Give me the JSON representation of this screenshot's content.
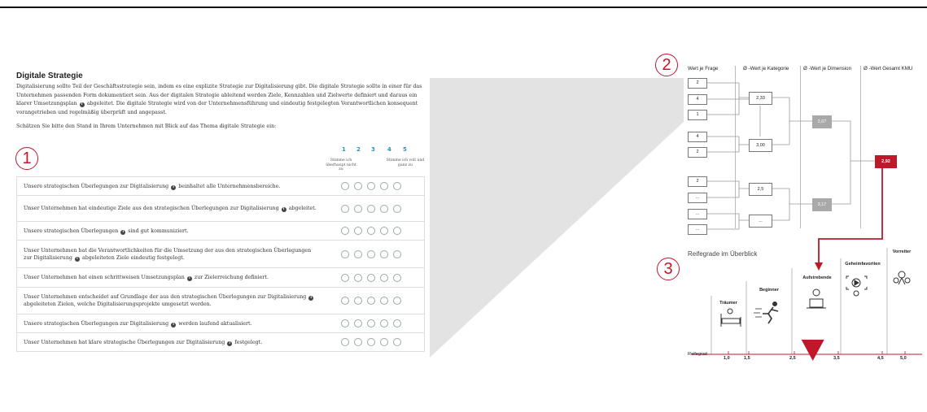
{
  "survey": {
    "title": "Digitale Strategie",
    "intro": "Digitalisierung sollte Teil der Geschäftsstrategie sein, indem es eine explizite Strategie zur Digitalisierung gibt. Die digitale Strategie sollte in einer für das Unternehmen passenden Form dokumentiert sein. Aus der digitalen Strategie ableitend werden Ziele, Kennzahlen und Zielwerte definiert und daraus ein klarer Umsetzungsplan",
    "intro_cont": "abgeleitet. Die digitale Strategie wird von der Unternehmensführung und eindeutig festgelegten Verantwortlichen konsequent vorangetrieben und regelmäßig überprüft und angepasst.",
    "prompt": "Schätzen Sie bitte den Stand in Ihrem Unternehmen mit Blick auf das Thema digitale Strategie ein:",
    "scale": [
      "1",
      "2",
      "3",
      "4",
      "5"
    ],
    "anchor_low": "Stimme ich überhaupt nicht zu",
    "anchor_high": "Stimme ich voll und ganz zu",
    "questions": [
      {
        "pre": "Unsere strategischen Überlegungen zur Digitalisierung",
        "post": "beinhaltet alle Unternehmensbereiche."
      },
      {
        "pre": "Unser Unternehmen hat eindeutige Ziele aus den strategischen Überlegungen zur Digitalisierung",
        "post": "abgeleitet."
      },
      {
        "pre": "Unsere strategischen Überlegungen",
        "post": "sind gut kommuniziert."
      },
      {
        "pre": "Unser Unternehmen hat die Verantwortlichkeiten für die Umsetzung der aus den strategischen Überlegungen zur Digitalisierung",
        "post": "abgeleiteten Ziele eindeutig festgelegt."
      },
      {
        "pre": "Unser Unternehmen hat einen schrittweisen Umsetzungsplan",
        "post": "zur Zielerreichung definiert."
      },
      {
        "pre": "Unser Unternehmen entscheidet auf Grundlage der aus den strategischen Überlegungen zur Digitalisierung",
        "post": "abgeleiteten Zielen, welche Digitalisierungsprojekte umgesetzt werden."
      },
      {
        "pre": "Unsere strategischen Überlegungen zur Digitalisierung",
        "post": "werden laufend aktualisiert."
      },
      {
        "pre": "Unser Unternehmen hat klare strategische Überlegungen zur Digitalisierung",
        "post": "festgelegt."
      }
    ]
  },
  "markers": {
    "one": "1",
    "two": "2",
    "three": "3"
  },
  "aggregation": {
    "headers": [
      "Wert je Frage",
      "Ø -Wert je Kategorie",
      "Ø -Wert je Dimension",
      "Ø -Wert Gesamt KMU"
    ],
    "questions": [
      "2",
      "4",
      "1",
      "4",
      "2",
      "2",
      "...",
      "...",
      "..."
    ],
    "categories": [
      "2,33",
      "3,00",
      "2,5",
      "..."
    ],
    "dimensions": [
      "2,67",
      "3,17"
    ],
    "total": "2,92"
  },
  "maturity": {
    "title": "Reifegrade im Überblick",
    "axis_label": "Reifegrad",
    "levels": [
      "Träumer",
      "Beginner",
      "Aufstrebende",
      "Geheimfavoriten",
      "Vorreiter"
    ],
    "ticks": [
      "1,0",
      "1,5",
      "2,5",
      "3,5",
      "4,5",
      "5,0"
    ],
    "marker_value": 2.92
  },
  "colors": {
    "accent": "#c0172b",
    "scale_blue": "#2a8fbd",
    "grey_box": "#a9a9a9"
  }
}
